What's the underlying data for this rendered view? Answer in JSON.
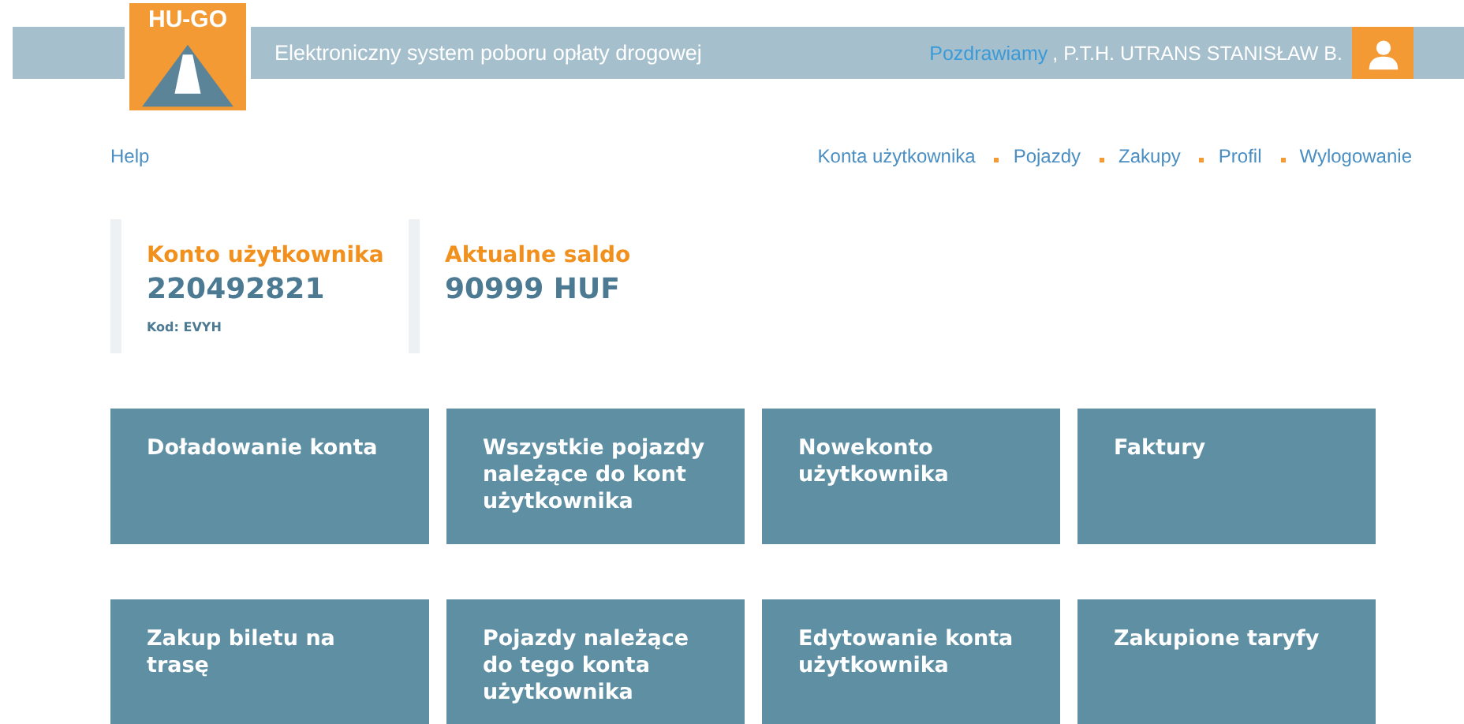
{
  "header": {
    "logo_text": "HU-GO",
    "subtitle": "Elektroniczny system poboru opłaty drogowej",
    "greeting": "Pozdrawiamy",
    "user": ", P.T.H. UTRANS STANISŁAW B."
  },
  "help": "Help",
  "nav": [
    "Konta użytkownika",
    "Pojazdy",
    "Zakupy",
    "Profil",
    "Wylogowanie"
  ],
  "cards": [
    {
      "label": "Konto użytkownika",
      "value": "220492821",
      "note": "Kod: EVYH"
    },
    {
      "label": "Aktualne saldo",
      "value": "90999 HUF"
    }
  ],
  "tiles": [
    "Doładowanie konta",
    "Wszystkie pojazdy należące do kont użytkownika",
    "Nowekonto użytkownika",
    "Faktury",
    "Zakup biletu na trasę",
    "Pojazdy należące do tego konta użytkownika",
    "Edytowanie konta użytkownika",
    "Zakupione taryfy"
  ]
}
